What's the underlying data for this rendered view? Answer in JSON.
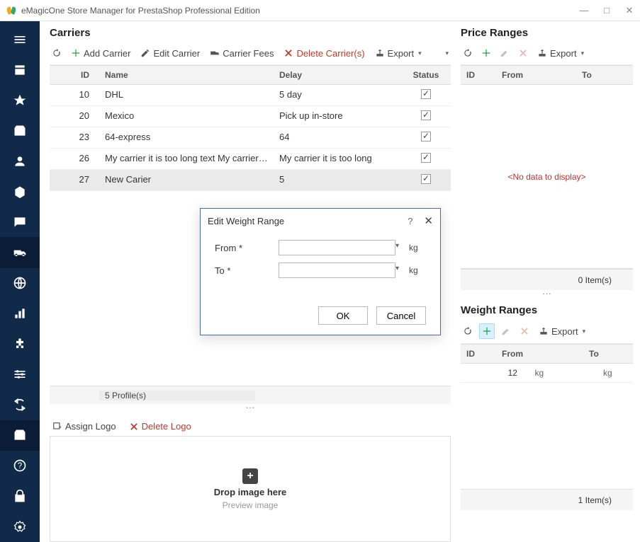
{
  "titlebar": {
    "title": "eMagicOne Store Manager for PrestaShop Professional Edition"
  },
  "carriers": {
    "title": "Carriers",
    "toolbar": {
      "add": "Add Carrier",
      "edit": "Edit Carrier",
      "fees": "Carrier Fees",
      "delete": "Delete Carrier(s)",
      "export": "Export"
    },
    "headers": {
      "id": "ID",
      "name": "Name",
      "delay": "Delay",
      "status": "Status"
    },
    "rows": [
      {
        "id": "10",
        "name": "DHL",
        "delay": "5 day",
        "status": true
      },
      {
        "id": "20",
        "name": "Mexico",
        "delay": "Pick up in-store",
        "status": true
      },
      {
        "id": "23",
        "name": "64-express",
        "delay": "64",
        "status": true
      },
      {
        "id": "26",
        "name": "My carrier it is too long text My carrier it is",
        "delay": "My carrier it is too long",
        "status": true
      },
      {
        "id": "27",
        "name": "New Carier",
        "delay": "5",
        "status": true
      }
    ],
    "footer": "5 Profile(s)"
  },
  "price_ranges": {
    "title": "Price Ranges",
    "export": "Export",
    "headers": {
      "id": "ID",
      "from": "From",
      "to": "To"
    },
    "empty": "<No data to display>",
    "footer": "0 Item(s)"
  },
  "weight_ranges": {
    "title": "Weight Ranges",
    "export": "Export",
    "headers": {
      "id": "ID",
      "from": "From",
      "to": "To"
    },
    "rows": [
      {
        "id": "",
        "from": "12",
        "from_unit": "kg",
        "to": "",
        "to_unit": "kg"
      }
    ],
    "footer": "1 Item(s)"
  },
  "logo": {
    "assign": "Assign Logo",
    "delete": "Delete Logo",
    "drop": "Drop image here",
    "preview": "Preview image"
  },
  "dialog": {
    "title": "Edit Weight Range",
    "from_label": "From *",
    "to_label": "To *",
    "unit": "kg",
    "ok": "OK",
    "cancel": "Cancel"
  }
}
